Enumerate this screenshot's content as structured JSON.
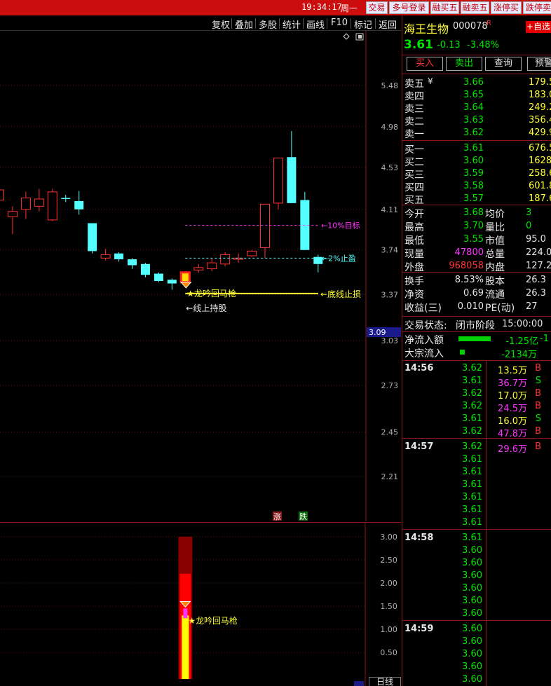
{
  "titlebar": {
    "time": "19:34:17",
    "weekday": "周一",
    "buttons": [
      "交易",
      "多号登录",
      "融买五",
      "融卖五",
      "涨停买",
      "跌停卖"
    ]
  },
  "toolbar": {
    "items": [
      "复权",
      "叠加",
      "多股",
      "统计",
      "画线",
      "F10",
      "标记",
      "返回"
    ]
  },
  "chart_data": [
    {
      "type": "candlestick",
      "y_ticks": [
        "5.48",
        "4.98",
        "4.53",
        "4.11",
        "3.74",
        "3.37",
        "3.03",
        "2.73",
        "2.45",
        "2.21"
      ],
      "y_tick_values": [
        5.48,
        4.98,
        4.53,
        4.11,
        3.74,
        3.37,
        3.03,
        2.73,
        2.45,
        2.21
      ],
      "current_price_tag": "3.09",
      "candles": [
        {
          "o": 4.2,
          "c": 4.3,
          "h": 4.4,
          "l": 3.85
        },
        {
          "o": 4.04,
          "c": 4.09,
          "h": 4.14,
          "l": 3.88
        },
        {
          "o": 4.11,
          "c": 4.22,
          "h": 4.28,
          "l": 4.02
        },
        {
          "o": 4.14,
          "c": 4.21,
          "h": 4.31,
          "l": 4.09
        },
        {
          "o": 4.01,
          "c": 4.28,
          "h": 4.31,
          "l": 4.0
        },
        {
          "o": 4.22,
          "c": 4.21,
          "h": 4.25,
          "l": 4.18
        },
        {
          "o": 4.19,
          "c": 4.11,
          "h": 4.29,
          "l": 4.06
        },
        {
          "o": 3.98,
          "c": 3.73,
          "h": 3.98,
          "l": 3.71
        },
        {
          "o": 3.67,
          "c": 3.7,
          "h": 3.75,
          "l": 3.65
        },
        {
          "o": 3.71,
          "c": 3.66,
          "h": 3.72,
          "l": 3.64
        },
        {
          "o": 3.66,
          "c": 3.61,
          "h": 3.67,
          "l": 3.58
        },
        {
          "o": 3.62,
          "c": 3.53,
          "h": 3.63,
          "l": 3.51
        },
        {
          "o": 3.54,
          "c": 3.48,
          "h": 3.55,
          "l": 3.47
        },
        {
          "o": 3.49,
          "c": 3.46,
          "h": 3.5,
          "l": 3.41
        },
        {
          "o": 3.47,
          "c": 3.55,
          "h": 3.56,
          "l": 3.46,
          "marker": true
        },
        {
          "o": 3.57,
          "c": 3.59,
          "h": 3.62,
          "l": 3.55
        },
        {
          "o": 3.58,
          "c": 3.63,
          "h": 3.67,
          "l": 3.56
        },
        {
          "o": 3.62,
          "c": 3.7,
          "h": 3.72,
          "l": 3.6
        },
        {
          "o": 3.66,
          "c": 3.67,
          "h": 3.71,
          "l": 3.63
        },
        {
          "o": 3.69,
          "c": 3.73,
          "h": 3.74,
          "l": 3.68
        },
        {
          "o": 3.76,
          "c": 4.16,
          "h": 4.16,
          "l": 3.67
        },
        {
          "o": 4.17,
          "c": 4.63,
          "h": 4.63,
          "l": 4.11
        },
        {
          "o": 4.64,
          "c": 4.17,
          "h": 4.93,
          "l": 4.17
        },
        {
          "o": 4.2,
          "c": 3.74,
          "h": 4.28,
          "l": 3.74
        },
        {
          "o": 3.68,
          "c": 3.62,
          "h": 3.7,
          "l": 3.55
        }
      ],
      "lines": {
        "target_label": "←10%目标",
        "target_value": 3.96,
        "take_profit_label": "←2%止盈",
        "take_profit_value": 3.67,
        "stop_loss_label": "←底线止损",
        "stop_loss_value": 3.38,
        "signal_label": "★龙吟回马枪",
        "hold_label": "←线上持股"
      },
      "flags": [
        "涨",
        "跌"
      ]
    },
    {
      "type": "bar",
      "y_ticks": [
        "3.00",
        "2.50",
        "2.00",
        "1.50",
        "1.00",
        "0.50"
      ],
      "y_tick_values": [
        3.0,
        2.5,
        2.0,
        1.5,
        1.0,
        0.5
      ],
      "bars": [
        {
          "value": 3.0,
          "color": "#8b0000"
        },
        {
          "value": 2.2,
          "color": "#ff0000"
        },
        {
          "value": 1.5,
          "color": "#ff0000"
        },
        {
          "value": 1.3,
          "color": "#ffff00"
        }
      ],
      "signal_label": "★龙吟回马枪"
    }
  ],
  "quote": {
    "name": "海王生物",
    "code": "000078",
    "code_suffix": "R",
    "add_label": "+自选",
    "price": "3.61",
    "change": "-0.13",
    "change_pct": "-3.48%",
    "action_buttons": [
      "买入",
      "卖出",
      "查询",
      "预警"
    ],
    "asks": [
      {
        "label": "卖五",
        "price": "3.66",
        "vol": "179.5"
      },
      {
        "label": "卖四",
        "price": "3.65",
        "vol": "183.0"
      },
      {
        "label": "卖三",
        "price": "3.64",
        "vol": "249.2"
      },
      {
        "label": "卖二",
        "price": "3.63",
        "vol": "356.4"
      },
      {
        "label": "卖一",
        "price": "3.62",
        "vol": "429.9"
      }
    ],
    "ask_marker": "¥",
    "bids": [
      {
        "label": "买一",
        "price": "3.61",
        "vol": "676.5"
      },
      {
        "label": "买二",
        "price": "3.60",
        "vol": "1628"
      },
      {
        "label": "买三",
        "price": "3.59",
        "vol": "258.6"
      },
      {
        "label": "买四",
        "price": "3.58",
        "vol": "601.8"
      },
      {
        "label": "买五",
        "price": "3.57",
        "vol": "187.6"
      }
    ],
    "stats": [
      {
        "l1": "今开",
        "v1": "3.68",
        "c1": "green",
        "l2": "均价",
        "v2": "3"
      },
      {
        "l1": "最高",
        "v1": "3.70",
        "c1": "green",
        "l2": "量比",
        "v2": "0"
      },
      {
        "l1": "最低",
        "v1": "3.55",
        "c1": "green",
        "l2": "市值",
        "v2": "95.0"
      },
      {
        "l1": "现量",
        "v1": "47800",
        "c1": "magenta",
        "l2": "总量",
        "v2": "224.0"
      },
      {
        "l1": "外盘",
        "v1": "968058",
        "c1": "red",
        "l2": "内盘",
        "v2": "127.2"
      }
    ],
    "stats2": [
      {
        "l1": "换手",
        "v1": "8.53%",
        "l2": "股本",
        "v2": "26.3"
      },
      {
        "l1": "净资",
        "v1": "0.69",
        "l2": "流通",
        "v2": "26.3"
      },
      {
        "l1": "收益(三)",
        "v1": "0.010",
        "l2": "PE(动)",
        "v2": "27"
      }
    ],
    "status_label": "交易状态:",
    "status_value": "闭市阶段",
    "status_time": "15:00:00",
    "netflow_label": "净流入额",
    "netflow_value": "-1.25亿",
    "netflow_extra": "-1",
    "block_label": "大宗流入",
    "block_value": "-2134万"
  },
  "ticks": [
    {
      "time": "14:56",
      "rows": [
        {
          "p": "3.62",
          "v": "13.5万",
          "s": "B",
          "vc": "yellow"
        },
        {
          "p": "3.61",
          "v": "36.7万",
          "s": "S",
          "vc": "magenta"
        },
        {
          "p": "3.62",
          "v": "17.0万",
          "s": "B",
          "vc": "yellow"
        },
        {
          "p": "3.62",
          "v": "24.5万",
          "s": "B",
          "vc": "magenta"
        },
        {
          "p": "3.61",
          "v": "16.0万",
          "s": "S",
          "vc": "yellow"
        },
        {
          "p": "3.62",
          "v": "47.8万",
          "s": "B",
          "vc": "magenta"
        }
      ]
    },
    {
      "time": "14:57",
      "rows": [
        {
          "p": "3.62",
          "v": "29.6万",
          "s": "B",
          "vc": "magenta"
        },
        {
          "p": "3.61",
          "v": "",
          "s": ""
        },
        {
          "p": "3.61",
          "v": "",
          "s": ""
        },
        {
          "p": "3.61",
          "v": "",
          "s": ""
        },
        {
          "p": "3.61",
          "v": "",
          "s": ""
        },
        {
          "p": "3.61",
          "v": "",
          "s": ""
        },
        {
          "p": "3.61",
          "v": "",
          "s": ""
        }
      ]
    },
    {
      "time": "14:58",
      "rows": [
        {
          "p": "3.61",
          "v": "",
          "s": ""
        },
        {
          "p": "3.60",
          "v": "",
          "s": ""
        },
        {
          "p": "3.60",
          "v": "",
          "s": ""
        },
        {
          "p": "3.60",
          "v": "",
          "s": ""
        },
        {
          "p": "3.60",
          "v": "",
          "s": ""
        },
        {
          "p": "3.60",
          "v": "",
          "s": ""
        },
        {
          "p": "3.60",
          "v": "",
          "s": ""
        }
      ]
    },
    {
      "time": "14:59",
      "rows": [
        {
          "p": "3.60",
          "v": "",
          "s": ""
        },
        {
          "p": "3.60",
          "v": "",
          "s": ""
        },
        {
          "p": "3.60",
          "v": "",
          "s": ""
        },
        {
          "p": "3.60",
          "v": "",
          "s": ""
        },
        {
          "p": "3.60",
          "v": "",
          "s": ""
        },
        {
          "p": "3.60",
          "v": "",
          "s": ""
        }
      ]
    }
  ],
  "bottom_tab": "日线"
}
